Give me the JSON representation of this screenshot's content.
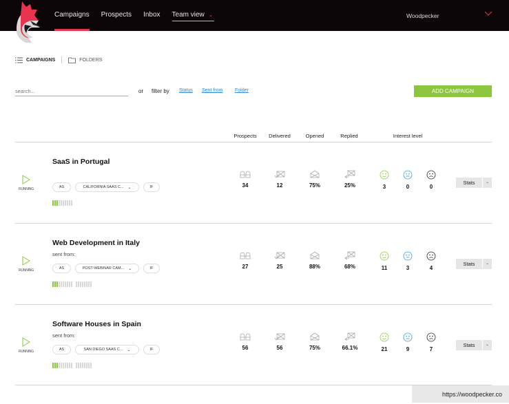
{
  "header": {
    "nav": [
      {
        "label": "Campaigns",
        "active": true
      },
      {
        "label": "Prospects",
        "active": false
      },
      {
        "label": "Inbox",
        "active": false
      },
      {
        "label": "Team view",
        "active": false,
        "dropdown": true
      }
    ],
    "user_name": "Woodpecker",
    "colors": {
      "background": "#0d0608",
      "accent": "#e8344e"
    }
  },
  "view_tabs": {
    "campaigns_label": "CAMPAIGNS",
    "folders_label": "FOLDERS"
  },
  "filters": {
    "search_placeholder": "search...",
    "or_label": "or",
    "filter_by_label": "filter by",
    "links": [
      "Status",
      "Sent from",
      "Folder"
    ]
  },
  "add_campaign_label": "ADD CAMPAIGN",
  "columns": {
    "prospects": "Prospects",
    "delivered": "Delivered",
    "opened": "Opened",
    "replied": "Replied",
    "interest": "Interest level"
  },
  "campaigns": [
    {
      "title": "SaaS in Portugal",
      "sent_from": "",
      "status": "RUNNING",
      "chips": {
        "as": "AS",
        "sender": "CALIFORNIA SAAS C...",
        "if": "IF"
      },
      "progress_steps": {
        "done": 3,
        "total": 10
      },
      "prospects": "34",
      "delivered": "12",
      "opened": "75%",
      "replied": "25%",
      "interest": {
        "positive": "3",
        "neutral": "0",
        "negative": "0"
      },
      "stats_label": "Stats"
    },
    {
      "title": "Web Development in Italy",
      "sent_from": "sent from:",
      "status": "RUNNING",
      "chips": {
        "as": "AS",
        "sender": "POST-WEBINAR CAM...",
        "if": "IF"
      },
      "progress_steps": {
        "done": 3,
        "total": 18
      },
      "prospects": "27",
      "delivered": "25",
      "opened": "88%",
      "replied": "68%",
      "interest": {
        "positive": "11",
        "neutral": "3",
        "negative": "4"
      },
      "stats_label": "Stats"
    },
    {
      "title": "Software Houses in Spain",
      "sent_from": "sent from:",
      "status": "RUNNING",
      "chips": {
        "as": "AS",
        "sender": "SAN DIEGO SAAS C...",
        "if": "IF"
      },
      "progress_steps": {
        "done": 3,
        "total": 18
      },
      "prospects": "56",
      "delivered": "56",
      "opened": "75%",
      "replied": "66.1%",
      "interest": {
        "positive": "21",
        "neutral": "9",
        "negative": "7"
      },
      "stats_label": "Stats"
    }
  ],
  "footer_url": "https://woodpecker.co",
  "colors": {
    "green": "#8cc63f",
    "link_blue": "#2b86d8",
    "neutral_blue": "#3a9ad9"
  }
}
